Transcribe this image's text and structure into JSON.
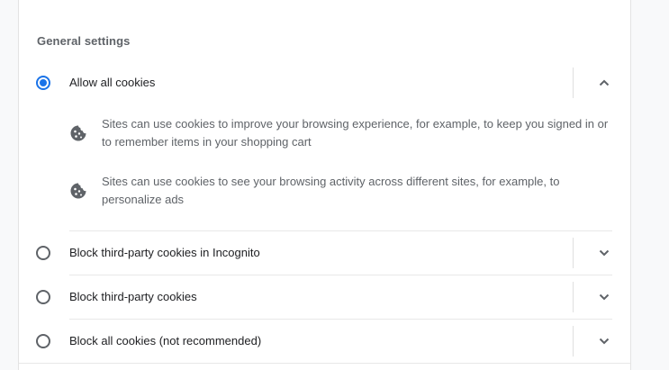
{
  "section": {
    "title": "General settings"
  },
  "options": [
    {
      "label": "Allow all cookies",
      "selected": true,
      "expanded": true,
      "details": [
        "Sites can use cookies to improve your browsing experience, for example, to keep you signed in or to remember items in your shopping cart",
        "Sites can use cookies to see your browsing activity across different sites, for example, to personalize ads"
      ]
    },
    {
      "label": "Block third-party cookies in Incognito",
      "selected": false,
      "expanded": false
    },
    {
      "label": "Block third-party cookies",
      "selected": false,
      "expanded": false
    },
    {
      "label": "Block all cookies (not recommended)",
      "selected": false,
      "expanded": false
    }
  ],
  "icons": {
    "detail": "cookie-icon",
    "expanded": "chevron-up-icon",
    "collapsed": "chevron-down-icon"
  },
  "colors": {
    "accent": "#1a73e8",
    "text_primary": "#202124",
    "text_secondary": "#5f6368"
  }
}
